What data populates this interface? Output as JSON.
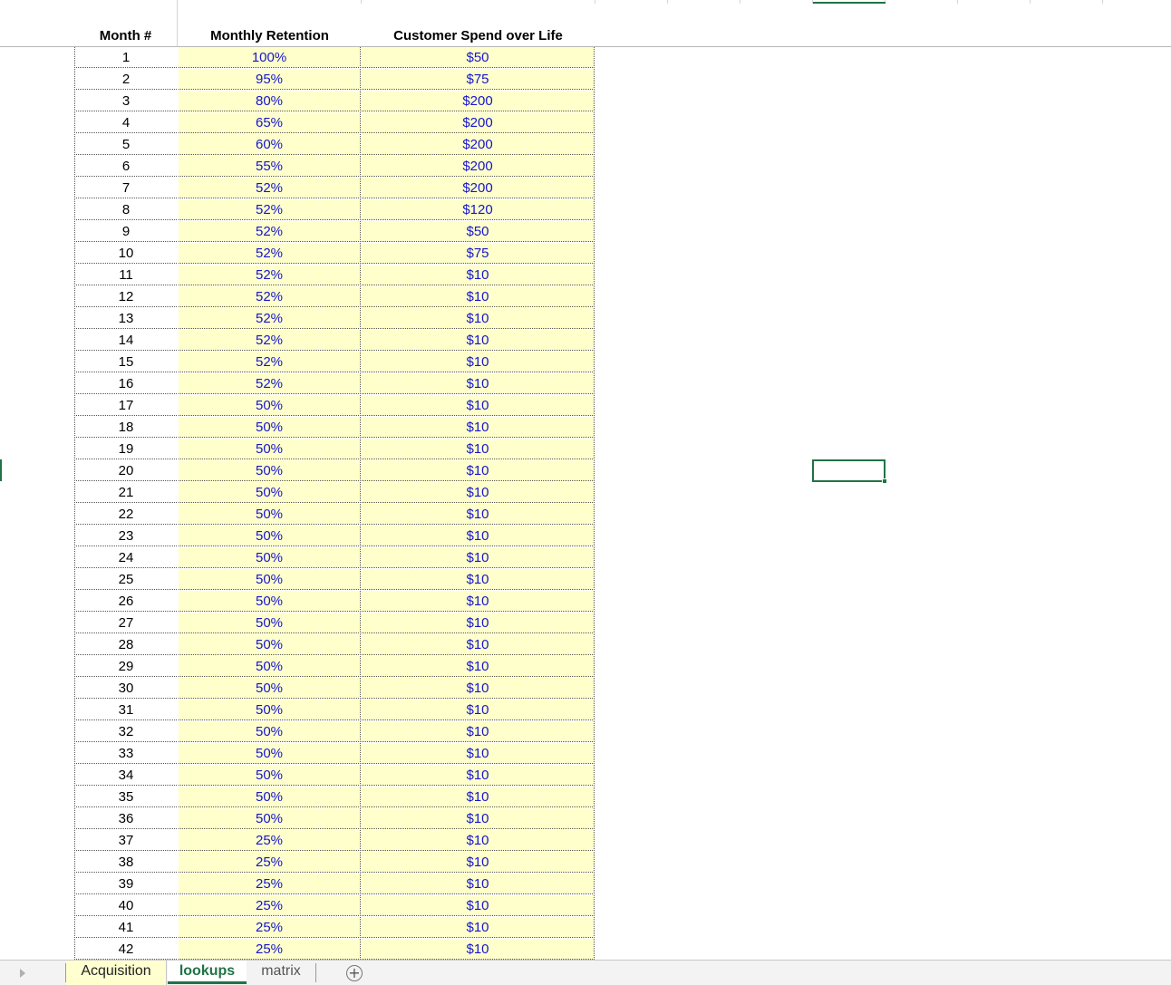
{
  "sheet": {
    "headers": {
      "month": "Month #",
      "retention": "Monthly Retention",
      "spend": "Customer Spend over Life"
    },
    "rows": [
      {
        "month": "1",
        "retention": "100%",
        "spend": "$50"
      },
      {
        "month": "2",
        "retention": "95%",
        "spend": "$75"
      },
      {
        "month": "3",
        "retention": "80%",
        "spend": "$200"
      },
      {
        "month": "4",
        "retention": "65%",
        "spend": "$200"
      },
      {
        "month": "5",
        "retention": "60%",
        "spend": "$200"
      },
      {
        "month": "6",
        "retention": "55%",
        "spend": "$200"
      },
      {
        "month": "7",
        "retention": "52%",
        "spend": "$200"
      },
      {
        "month": "8",
        "retention": "52%",
        "spend": "$120"
      },
      {
        "month": "9",
        "retention": "52%",
        "spend": "$50"
      },
      {
        "month": "10",
        "retention": "52%",
        "spend": "$75"
      },
      {
        "month": "11",
        "retention": "52%",
        "spend": "$10"
      },
      {
        "month": "12",
        "retention": "52%",
        "spend": "$10"
      },
      {
        "month": "13",
        "retention": "52%",
        "spend": "$10"
      },
      {
        "month": "14",
        "retention": "52%",
        "spend": "$10"
      },
      {
        "month": "15",
        "retention": "52%",
        "spend": "$10"
      },
      {
        "month": "16",
        "retention": "52%",
        "spend": "$10"
      },
      {
        "month": "17",
        "retention": "50%",
        "spend": "$10"
      },
      {
        "month": "18",
        "retention": "50%",
        "spend": "$10"
      },
      {
        "month": "19",
        "retention": "50%",
        "spend": "$10"
      },
      {
        "month": "20",
        "retention": "50%",
        "spend": "$10"
      },
      {
        "month": "21",
        "retention": "50%",
        "spend": "$10"
      },
      {
        "month": "22",
        "retention": "50%",
        "spend": "$10"
      },
      {
        "month": "23",
        "retention": "50%",
        "spend": "$10"
      },
      {
        "month": "24",
        "retention": "50%",
        "spend": "$10"
      },
      {
        "month": "25",
        "retention": "50%",
        "spend": "$10"
      },
      {
        "month": "26",
        "retention": "50%",
        "spend": "$10"
      },
      {
        "month": "27",
        "retention": "50%",
        "spend": "$10"
      },
      {
        "month": "28",
        "retention": "50%",
        "spend": "$10"
      },
      {
        "month": "29",
        "retention": "50%",
        "spend": "$10"
      },
      {
        "month": "30",
        "retention": "50%",
        "spend": "$10"
      },
      {
        "month": "31",
        "retention": "50%",
        "spend": "$10"
      },
      {
        "month": "32",
        "retention": "50%",
        "spend": "$10"
      },
      {
        "month": "33",
        "retention": "50%",
        "spend": "$10"
      },
      {
        "month": "34",
        "retention": "50%",
        "spend": "$10"
      },
      {
        "month": "35",
        "retention": "50%",
        "spend": "$10"
      },
      {
        "month": "36",
        "retention": "50%",
        "spend": "$10"
      },
      {
        "month": "37",
        "retention": "25%",
        "spend": "$10"
      },
      {
        "month": "38",
        "retention": "25%",
        "spend": "$10"
      },
      {
        "month": "39",
        "retention": "25%",
        "spend": "$10"
      },
      {
        "month": "40",
        "retention": "25%",
        "spend": "$10"
      },
      {
        "month": "41",
        "retention": "25%",
        "spend": "$10"
      },
      {
        "month": "42",
        "retention": "25%",
        "spend": "$10"
      }
    ]
  },
  "tabs": {
    "acquisition": "Acquisition",
    "lookups": "lookups",
    "matrix": "matrix",
    "active": "lookups",
    "add_symbol": "+"
  },
  "colors": {
    "input_fill": "#ffffcc",
    "input_text": "#1515d0",
    "accent": "#217346"
  },
  "icons": {
    "scroll_left": "triangle-right-icon",
    "add_sheet": "plus-circle-icon"
  }
}
